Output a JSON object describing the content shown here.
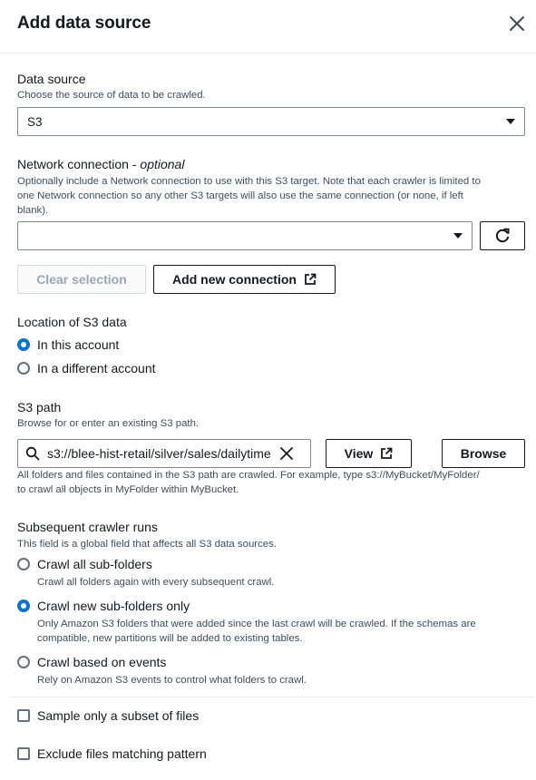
{
  "header": {
    "title": "Add data source"
  },
  "data_source": {
    "label": "Data source",
    "description": "Choose the source of data to be crawled.",
    "selected": "S3"
  },
  "network": {
    "label": "Network connection - ",
    "optional": "optional",
    "description_line1": "Optionally include a Network connection to use with this S3 target. Note that each crawler is limited to",
    "description_line2": "one Network connection so any other S3 targets will also use the same connection (or none, if left",
    "description_line3": "blank).",
    "selected": "",
    "clear_label": "Clear selection",
    "add_label": "Add new connection"
  },
  "location": {
    "label": "Location of S3 data",
    "options": [
      "In this account",
      "In a different account"
    ],
    "selected_index": 0
  },
  "s3_path": {
    "label": "S3 path",
    "description": "Browse for or enter an existing S3 path.",
    "value": "s3://blee-hist-retail/silver/sales/dailytime",
    "view_label": "View",
    "browse_label": "Browse",
    "help_line1": "All folders and files contained in the S3 path are crawled. For example, type s3://MyBucket/MyFolder/",
    "help_line2": "to crawl all objects in MyFolder within MyBucket."
  },
  "subsequent": {
    "label": "Subsequent crawler runs",
    "description": "This field is a global field that affects all S3 data sources.",
    "options": [
      {
        "label": "Crawl all sub-folders",
        "desc1": "Crawl all folders again with every subsequent crawl.",
        "desc2": ""
      },
      {
        "label": "Crawl new sub-folders only",
        "desc1": "Only Amazon S3 folders that were added since the last crawl will be crawled. If the schemas are",
        "desc2": "compatible, new partitions will be added to existing tables."
      },
      {
        "label": "Crawl based on events",
        "desc1": "Rely on Amazon S3 events to control what folders to crawl.",
        "desc2": ""
      }
    ],
    "selected_index": 1
  },
  "checkboxes": {
    "sample": "Sample only a subset of files",
    "exclude": "Exclude files matching pattern"
  },
  "colors": {
    "accent": "#0972d3",
    "text": "#16191f",
    "muted": "#414d5c",
    "border": "#7d8998"
  }
}
